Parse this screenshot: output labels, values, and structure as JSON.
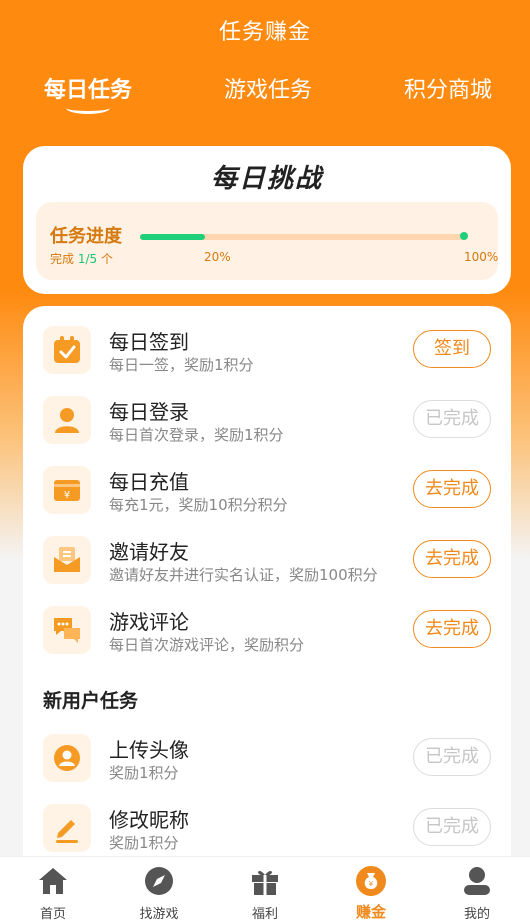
{
  "header": {
    "title": "任务赚金"
  },
  "tabs": [
    {
      "label": "每日任务",
      "active": true
    },
    {
      "label": "游戏任务",
      "active": false
    },
    {
      "label": "积分商城",
      "active": false
    }
  ],
  "challenge": {
    "title": "每日挑战",
    "progress_label": "任务进度",
    "completed_prefix": "完成",
    "completed_count": "1/5",
    "completed_suffix": "个",
    "progress_fraction": 0.2,
    "tick_mid": "20%",
    "tick_end": "100%"
  },
  "daily_tasks": [
    {
      "name": "每日签到",
      "desc": "每日一签，奖励1积分",
      "button": "签到",
      "done": false,
      "icon": "calendar-check-icon"
    },
    {
      "name": "每日登录",
      "desc": "每日首次登录，奖励1积分",
      "button": "已完成",
      "done": true,
      "icon": "user-icon"
    },
    {
      "name": "每日充值",
      "desc": "每充1元，奖励10积分积分",
      "button": "去完成",
      "done": false,
      "icon": "wallet-yuan-icon"
    },
    {
      "name": "邀请好友",
      "desc": "邀请好友并进行实名认证，奖励100积分",
      "button": "去完成",
      "done": false,
      "icon": "envelope-icon"
    },
    {
      "name": "游戏评论",
      "desc": "每日首次游戏评论，奖励积分",
      "button": "去完成",
      "done": false,
      "icon": "comment-icon"
    }
  ],
  "new_user_section": {
    "title": "新用户任务"
  },
  "new_user_tasks": [
    {
      "name": "上传头像",
      "desc": "奖励1积分",
      "button": "已完成",
      "done": true,
      "icon": "avatar-upload-icon"
    },
    {
      "name": "修改昵称",
      "desc": "奖励1积分",
      "button": "已完成",
      "done": true,
      "icon": "edit-icon"
    }
  ],
  "bottom_nav": [
    {
      "label": "首页",
      "icon": "home-icon",
      "active": false
    },
    {
      "label": "找游戏",
      "icon": "compass-icon",
      "active": false
    },
    {
      "label": "福利",
      "icon": "gift-icon",
      "active": false
    },
    {
      "label": "赚金",
      "icon": "money-bag-icon",
      "active": true
    },
    {
      "label": "我的",
      "icon": "profile-icon",
      "active": false
    }
  ],
  "colors": {
    "primary": "#ff8a10",
    "accent_text": "#f08a1c",
    "progress_fill": "#1fcf7a",
    "done_button": "#c6c6c6"
  }
}
